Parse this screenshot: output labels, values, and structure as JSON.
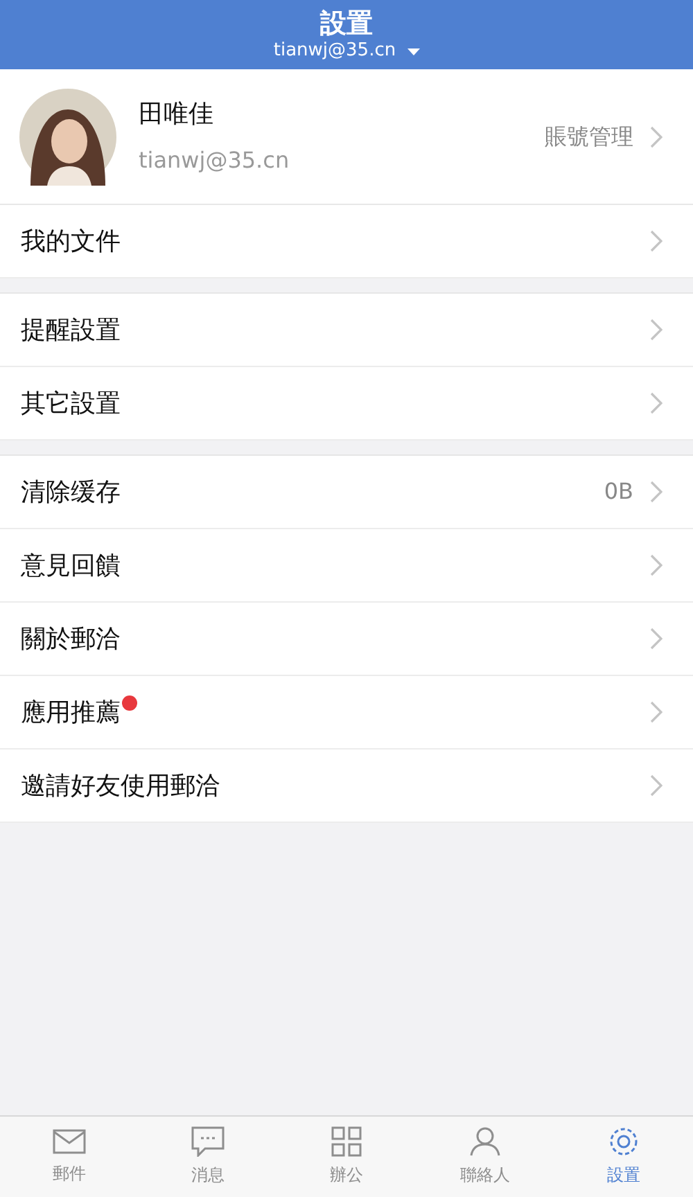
{
  "header": {
    "title": "設置",
    "account": "tianwj@35.cn"
  },
  "profile": {
    "name": "田唯佳",
    "email": "tianwj@35.cn",
    "action": "賬號管理"
  },
  "groups": [
    [
      {
        "label": "我的文件",
        "badge": false
      }
    ],
    [
      {
        "label": "提醒設置",
        "badge": false
      },
      {
        "label": "其它設置",
        "badge": false
      }
    ],
    [
      {
        "label": "清除缓存",
        "value": "0B",
        "badge": false
      },
      {
        "label": "意見回饋",
        "badge": false
      },
      {
        "label": "關於郵洽",
        "badge": false
      },
      {
        "label": "應用推薦",
        "badge": true
      },
      {
        "label": "邀請好友使用郵洽",
        "badge": false
      }
    ]
  ],
  "tab_bar": [
    {
      "kind": "mail",
      "label": "郵件",
      "selected": false
    },
    {
      "kind": "chat",
      "label": "消息",
      "selected": false
    },
    {
      "kind": "grid",
      "label": "辦公",
      "selected": false
    },
    {
      "kind": "person",
      "label": "聯絡人",
      "selected": false
    },
    {
      "kind": "gear",
      "label": "設置",
      "selected": true
    }
  ]
}
